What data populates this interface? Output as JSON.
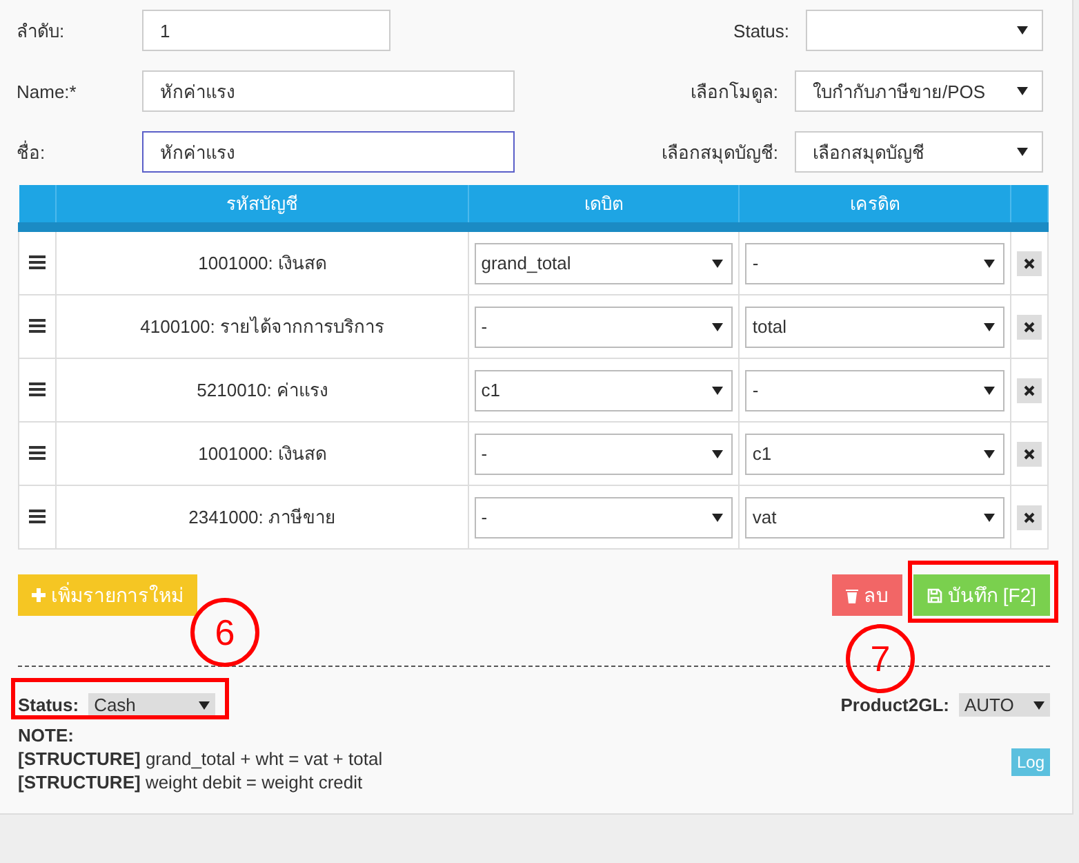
{
  "form": {
    "left": [
      {
        "label": "ลำดับ:",
        "value": "1",
        "focused": false
      },
      {
        "label": "Name:*",
        "value": "หักค่าแรง",
        "focused": false
      },
      {
        "label": "ชื่อ:",
        "value": "หักค่าแรง",
        "focused": true
      }
    ],
    "right": [
      {
        "label": "Status:"
      },
      {
        "label": "เลือกโมดูล:",
        "value": "ใบกำกับภาษีขาย/POS"
      },
      {
        "label": "เลือกสมุดบัญชี:",
        "value": "เลือกสมุดบัญชี"
      }
    ]
  },
  "table": {
    "columns": [
      "รหัสบัญชี",
      "เดบิต",
      "เครดิต"
    ],
    "rows": [
      {
        "account": "1001000: เงินสด",
        "debit": "grand_total",
        "credit": "-"
      },
      {
        "account": "4100100: รายได้จากการบริการ",
        "debit": "-",
        "credit": "total"
      },
      {
        "account": "5210010: ค่าแรง",
        "debit": "c1",
        "credit": "-"
      },
      {
        "account": "1001000: เงินสด",
        "debit": "-",
        "credit": "c1"
      },
      {
        "account": "2341000: ภาษีขาย",
        "debit": "-",
        "credit": "vat"
      }
    ]
  },
  "buttons": {
    "add": "เพิ่มรายการใหม่",
    "delete": "ลบ",
    "save": "บันทึก [F2]"
  },
  "footer": {
    "status_label": "Status:",
    "status_value": "Cash",
    "product_label": "Product2GL:",
    "product_value": "AUTO",
    "note": "NOTE:",
    "lines": [
      "**[STRUCTURE]** grand_total + wht = vat + total",
      "**[STRUCTURE]** weight debit = weight credit"
    ],
    "log": "Log"
  },
  "annotations": [
    {
      "label": "6"
    },
    {
      "label": "7"
    }
  ]
}
